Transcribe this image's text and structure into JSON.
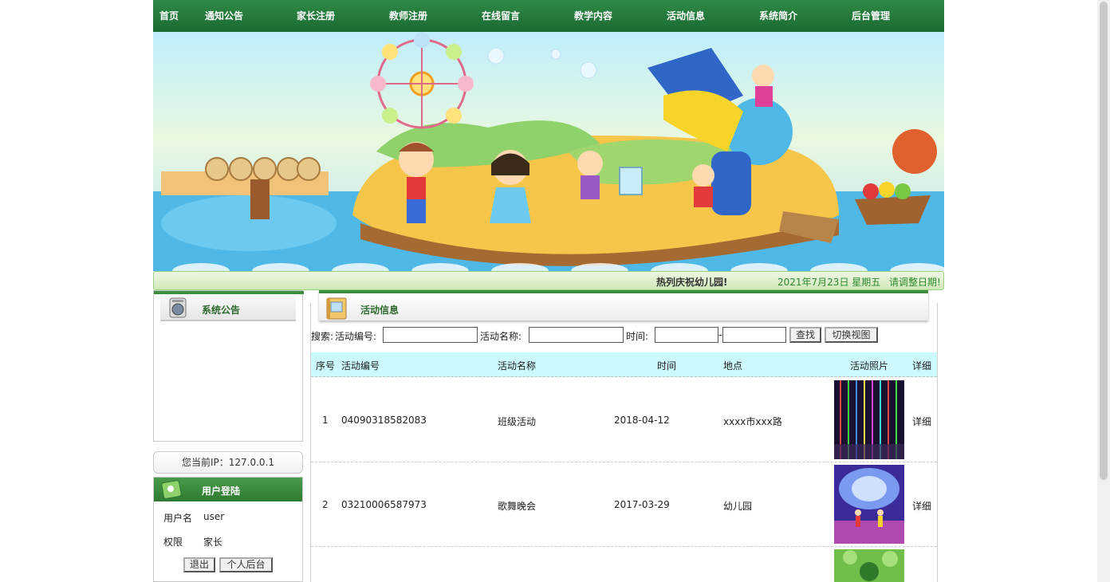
{
  "nav": {
    "items": [
      "首页",
      "通知公告",
      "家长注册",
      "教师注册",
      "在线留言",
      "教学内容",
      "活动信息",
      "系统简介",
      "后台管理"
    ]
  },
  "ticker": {
    "message": "热列庆祝幼儿园!",
    "date": "2021年7月23日 星期五",
    "tip": "请调整日期!"
  },
  "sidebar": {
    "notice_title": "系统公告",
    "ip_text": "您当前IP：127.0.0.1",
    "login": {
      "title": "用户登陆",
      "username_label": "用户名",
      "username_value": "user",
      "role_label": "权限",
      "role_value": "家长",
      "logout_label": "退出",
      "backend_label": "个人后台"
    }
  },
  "main": {
    "title": "活动信息",
    "search": {
      "label": "搜索:",
      "id_label": "活动编号:",
      "name_label": "活动名称:",
      "time_label": "时间:",
      "separator": "-",
      "find_label": "查找",
      "toggle_label": "切换视图"
    },
    "columns": [
      "序号",
      "活动编号",
      "活动名称",
      "时间",
      "地点",
      "活动照片",
      "详细"
    ],
    "rows": [
      {
        "index": "1",
        "code": "04090318582083",
        "name": "班级活动",
        "date": "2018-04-12",
        "place": "xxxx市xxx路",
        "detail": "详细",
        "photo": "lights-photo"
      },
      {
        "index": "2",
        "code": "03210006587973",
        "name": "歌舞晚会",
        "date": "2017-03-29",
        "place": "幼儿园",
        "detail": "详细",
        "photo": "stage-photo"
      },
      {
        "index": "",
        "code": "",
        "name": "",
        "date": "",
        "place": "",
        "detail": "",
        "photo": "garden-photo"
      }
    ]
  },
  "colors": {
    "nav_green": "#1b6a31",
    "header_cyan": "#ccf9fb",
    "ticker_green": "#2e8a2e"
  }
}
